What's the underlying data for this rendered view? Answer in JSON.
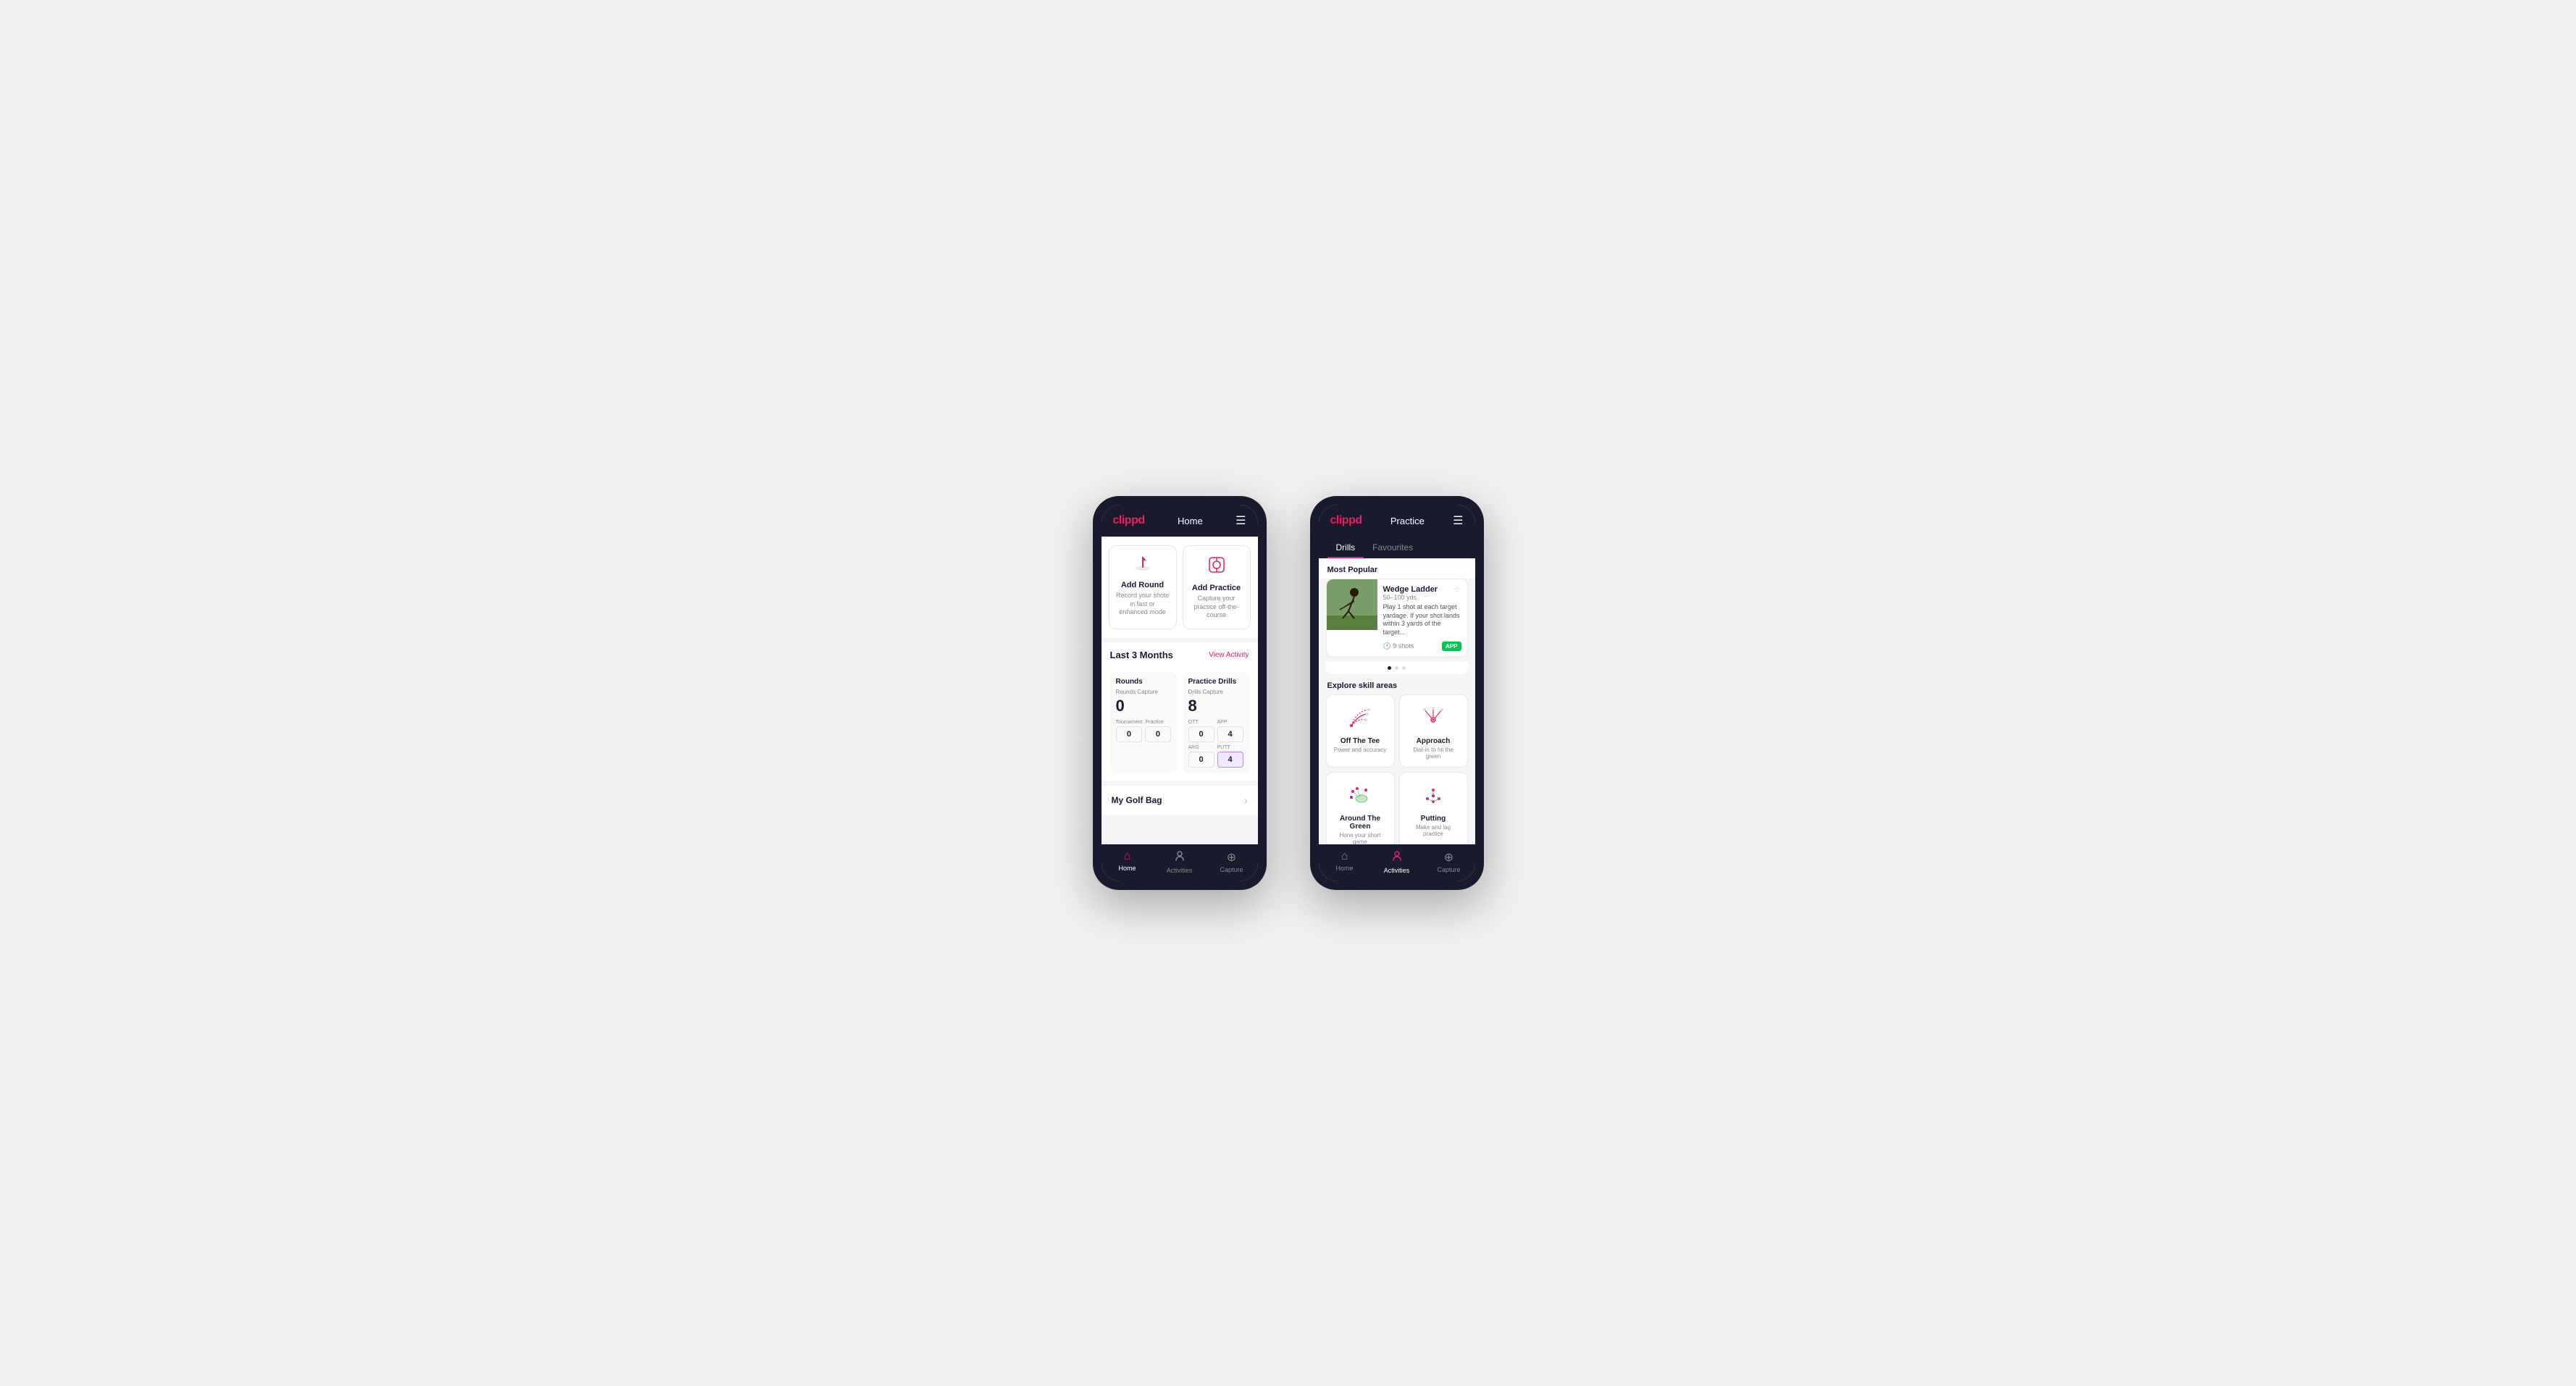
{
  "phone1": {
    "header": {
      "logo": "clippd",
      "title": "Home"
    },
    "actions": [
      {
        "id": "add-round",
        "icon": "⛳",
        "title": "Add Round",
        "desc": "Record your shots in fast or enhanced mode"
      },
      {
        "id": "add-practice",
        "icon": "📋",
        "title": "Add Practice",
        "desc": "Capture your practice off-the-course"
      }
    ],
    "last3months": {
      "label": "Last 3 Months",
      "link": "View Activity"
    },
    "stats": {
      "rounds": {
        "title": "Rounds",
        "captureLabel": "Rounds Capture",
        "total": "0",
        "rows": [
          {
            "label": "Tournament",
            "value": "0"
          },
          {
            "label": "Practice",
            "value": "0"
          }
        ]
      },
      "drills": {
        "title": "Practice Drills",
        "captureLabel": "Drills Capture",
        "total": "8",
        "rows": [
          {
            "label": "OTT",
            "value": "0",
            "highlighted": false
          },
          {
            "label": "APP",
            "value": "4",
            "highlighted": false
          },
          {
            "label": "ARG",
            "value": "0",
            "highlighted": false
          },
          {
            "label": "PUTT",
            "value": "4",
            "highlighted": true
          }
        ]
      }
    },
    "golfBag": "My Golf Bag",
    "nav": [
      {
        "label": "Home",
        "active": true
      },
      {
        "label": "Activities",
        "active": false
      },
      {
        "label": "Capture",
        "active": false
      }
    ]
  },
  "phone2": {
    "header": {
      "logo": "clippd",
      "title": "Practice"
    },
    "tabs": [
      {
        "label": "Drills",
        "active": true
      },
      {
        "label": "Favourites",
        "active": false
      }
    ],
    "mostPopular": "Most Popular",
    "drillCard": {
      "title": "Wedge Ladder",
      "subtitle": "50–100 yds",
      "desc": "Play 1 shot at each target yardage. If your shot lands within 3 yards of the target...",
      "shots": "9 shots",
      "badge": "APP"
    },
    "dots": [
      true,
      false,
      false
    ],
    "exploreLabel": "Explore skill areas",
    "skills": [
      {
        "id": "off-the-tee",
        "name": "Off The Tee",
        "desc": "Power and accuracy",
        "icon": "tee"
      },
      {
        "id": "approach",
        "name": "Approach",
        "desc": "Dial-in to hit the green",
        "icon": "approach"
      },
      {
        "id": "around-the-green",
        "name": "Around The Green",
        "desc": "Hone your short game",
        "icon": "atg"
      },
      {
        "id": "putting",
        "name": "Putting",
        "desc": "Make and lag practice",
        "icon": "putting"
      }
    ],
    "nav": [
      {
        "label": "Home",
        "active": false
      },
      {
        "label": "Activities",
        "active": true
      },
      {
        "label": "Capture",
        "active": false
      }
    ]
  }
}
